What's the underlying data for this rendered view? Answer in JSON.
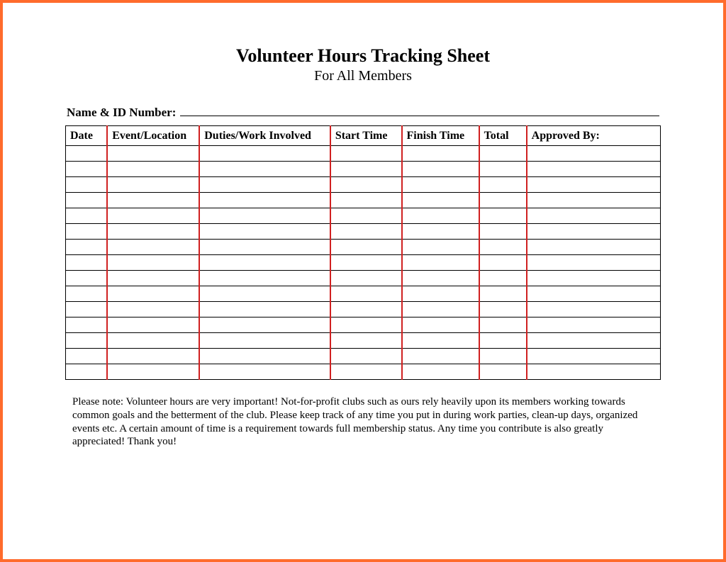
{
  "header": {
    "title": "Volunteer Hours Tracking Sheet",
    "subtitle": "For All  Members"
  },
  "nameField": {
    "label": "Name & ID Number:"
  },
  "table": {
    "columns": [
      "Date",
      "Event/Location",
      "Duties/Work Involved",
      "Start Time",
      "Finish Time",
      "Total",
      "Approved By:"
    ],
    "rowCount": 15
  },
  "note": "Please note: Volunteer hours are very important! Not-for-profit clubs such as ours rely heavily upon its members working towards common goals and the betterment of the club. Please keep track of any time you put in during work parties, clean-up days, organized events etc. A certain amount of time is a requirement towards full membership status. Any time you contribute is also greatly appreciated! Thank you!"
}
